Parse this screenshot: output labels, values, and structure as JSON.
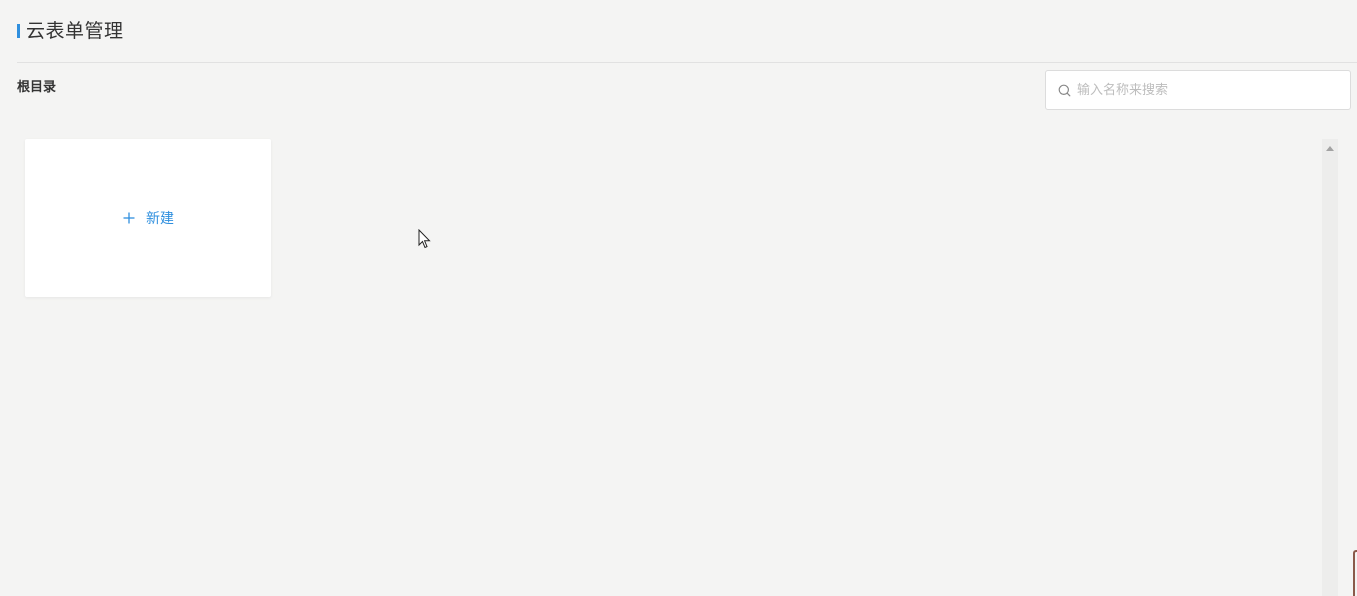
{
  "header": {
    "title": "云表单管理"
  },
  "breadcrumb": {
    "label": "根目录"
  },
  "search": {
    "placeholder": "输入名称来搜索",
    "value": ""
  },
  "new_card": {
    "label": "新建"
  },
  "colors": {
    "accent": "#2f8fde",
    "background": "#f4f4f3",
    "card": "#ffffff"
  }
}
